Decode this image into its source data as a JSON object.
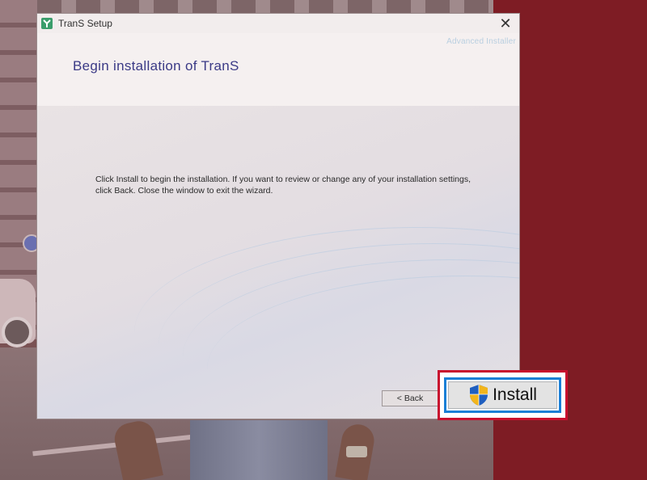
{
  "window": {
    "title": "TranS Setup",
    "brand": "Advanced Installer",
    "close_icon": "close-icon",
    "app_icon": "trans-logo-icon"
  },
  "page": {
    "heading": "Begin installation of TranS",
    "body_line1": "Click Install to begin the installation.  If you want to review or change any of your installation settings,",
    "body_line2": "click Back.  Close the window to exit the wizard."
  },
  "buttons": {
    "back_label": "< Back",
    "install_label": "Install",
    "install_icon": "uac-shield-icon"
  },
  "colors": {
    "highlight_border": "#c8102e",
    "focus_border": "#1a7fd6",
    "heading": "#3b3a86"
  }
}
